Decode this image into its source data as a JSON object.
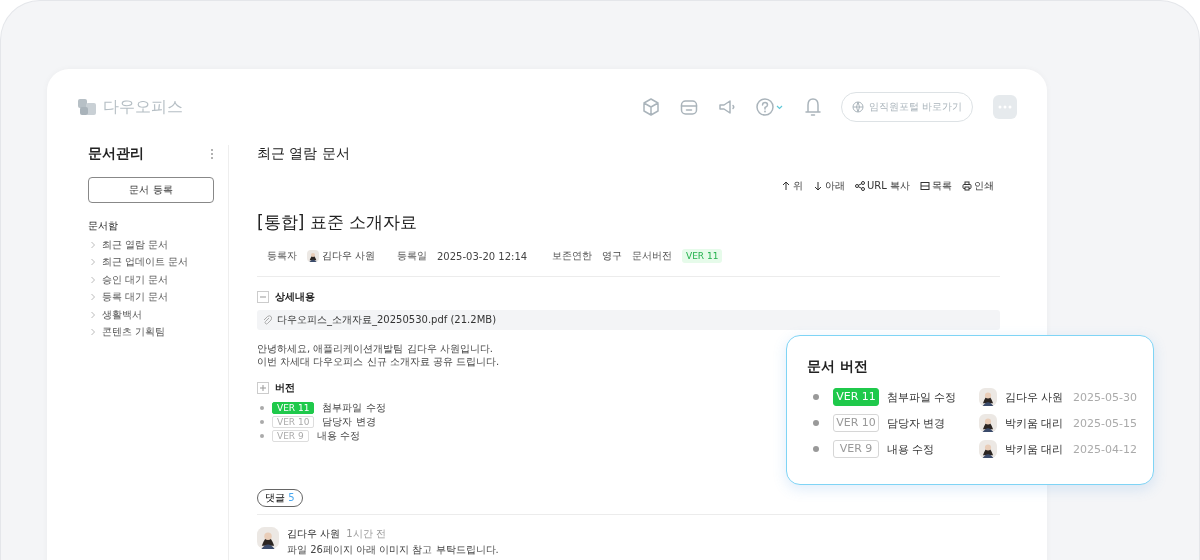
{
  "app": {
    "logo": "다우오피스",
    "portal_button": "임직원포털 바로가기"
  },
  "sidebar": {
    "title": "문서관리",
    "register_button": "문서 등록",
    "section": "문서함",
    "items": [
      {
        "label": "최근 열람 문서"
      },
      {
        "label": "최근 업데이트 문서"
      },
      {
        "label": "승인 대기 문서"
      },
      {
        "label": "등록 대기 문서"
      },
      {
        "label": "생활백서"
      },
      {
        "label": "콘텐츠 기획팀"
      }
    ]
  },
  "content": {
    "page_title": "최근 열람 문서",
    "toolbar": [
      {
        "kind": "up",
        "label": "위"
      },
      {
        "kind": "down",
        "label": "아래"
      },
      {
        "kind": "share",
        "label": "URL 복사"
      },
      {
        "kind": "list",
        "label": "목록"
      },
      {
        "kind": "print",
        "label": "인쇄"
      }
    ],
    "document": {
      "title": "[통합] 표준 소개자료",
      "meta": [
        {
          "kind": "person",
          "label": "등록자",
          "value": "김다우 사원"
        },
        {
          "kind": "text",
          "label": "등록일",
          "value": "2025-03-20 12:14"
        },
        {
          "kind": "text",
          "label": "보존연한",
          "value": "영구"
        },
        {
          "kind": "version",
          "label": "문서버전",
          "value": "VER 11"
        }
      ],
      "details": {
        "heading": "상세내용",
        "expanded": true,
        "attachment": "다우오피스_소개자료_20250530.pdf (21.2MB)",
        "body": [
          "안녕하세요, 애플리케이션개발팀 김다우 사원입니다.",
          "이번 차세대 다우오피스 신규 소개자료 공유 드립니다."
        ]
      },
      "versions": {
        "heading": "버전",
        "expanded": false,
        "items": [
          {
            "version": "VER 11",
            "note": "첨부파일 수정",
            "current": true
          },
          {
            "version": "VER 10",
            "note": "담당자 변경",
            "current": false
          },
          {
            "version": "VER 9",
            "note": "내용 수정",
            "current": false
          }
        ]
      }
    },
    "comments": {
      "label": "댓글",
      "count": "5",
      "items": [
        {
          "author": "김다우 사원",
          "time": "1시간 전",
          "text": "파일 26페이지 아래 이미지 참고 부탁드립니다."
        }
      ]
    }
  },
  "popup": {
    "title": "문서 버전",
    "items": [
      {
        "version": "VER 11",
        "note": "첨부파일 수정",
        "author": "김다우 사원",
        "date": "2025-05-30",
        "current": true
      },
      {
        "version": "VER 10",
        "note": "담당자 변경",
        "author": "박키움 대리",
        "date": "2025-05-15",
        "current": false
      },
      {
        "version": "VER 9",
        "note": "내용 수정",
        "author": "박키움 대리",
        "date": "2025-04-12",
        "current": false
      }
    ]
  }
}
